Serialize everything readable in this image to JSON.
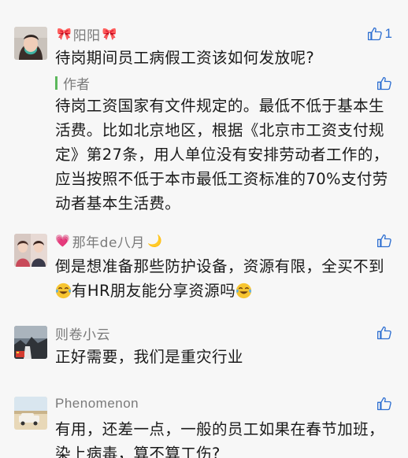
{
  "comments": [
    {
      "nickname": "阳阳",
      "deco_left": "🎀",
      "deco_right": "🎀",
      "text": "待岗期间员工病假工资该如何发放呢?",
      "likes": "1",
      "author_reply": {
        "label": "作者",
        "text": "待岗工资国家有文件规定的。最低不低于基本生活费。比如北京地区，根据《北京市工资支付规定》第27条，用人单位没有安排劳动者工作的，应当按照不低于本市最低工资标准的70%支付劳动者基本生活费。"
      }
    },
    {
      "nickname": "那年de八月",
      "deco_left": "💗",
      "deco_right": "🌙",
      "text_part1": "倒是想准备那些防护设备，资源有限，全买不到",
      "text_part2": "有HR朋友能分享资源吗"
    },
    {
      "nickname": "则卷小云",
      "text": "正好需要，我们是重灾行业"
    },
    {
      "nickname": "Phenomenon",
      "text": "有用，还差一点，一般的员工如果在春节加班，染上病毒，算不算工伤?"
    }
  ],
  "icons": {
    "like": "thumbs-up-icon",
    "emoji": "crying-laughing-emoji"
  },
  "colors": {
    "background": "#f7f7f7",
    "like_blue": "#2e6fd1",
    "author_bar": "#5cb85c",
    "nickname_gray": "#7a7a7a"
  }
}
